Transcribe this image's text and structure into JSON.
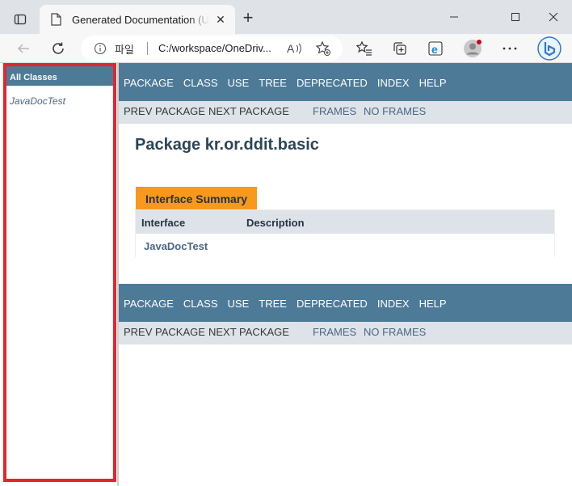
{
  "browser": {
    "tab_title": "Generated Documentation (Untitled)",
    "new_tab_label": "+",
    "address": {
      "site_label": "파일",
      "url": "C:/workspace/OneDriv..."
    }
  },
  "left_frame": {
    "header": "All Classes",
    "classes": [
      "JavaDocTest"
    ]
  },
  "top_navbar": {
    "items": [
      "PACKAGE",
      "CLASS",
      "USE",
      "TREE",
      "DEPRECATED",
      "INDEX",
      "HELP"
    ]
  },
  "top_subnav": {
    "prev": "PREV PACKAGE",
    "next": "NEXT PACKAGE",
    "frames": "FRAMES",
    "no_frames": "NO FRAMES"
  },
  "main": {
    "package_title": "Package kr.or.ddit.basic",
    "summary_tab": "Interface Summary",
    "columns": [
      "Interface",
      "Description"
    ],
    "rows": [
      {
        "name": "JavaDocTest",
        "description": ""
      }
    ]
  },
  "bottom_navbar": {
    "items": [
      "PACKAGE",
      "CLASS",
      "USE",
      "TREE",
      "DEPRECATED",
      "INDEX",
      "HELP"
    ]
  },
  "bottom_subnav": {
    "prev": "PREV PACKAGE",
    "next": "NEXT PACKAGE",
    "frames": "FRAMES",
    "no_frames": "NO FRAMES"
  },
  "colors": {
    "navbar": "#4d7a97",
    "subnav": "#dee3e9",
    "summary_tab": "#f8981d",
    "link": "#4a6782",
    "highlight_border": "#e0262e"
  },
  "icons": [
    "tab-actions-icon",
    "page-icon",
    "close-icon",
    "minimize-icon",
    "maximize-icon",
    "window-close-icon",
    "back-icon",
    "refresh-icon",
    "info-icon",
    "read-aloud-icon",
    "add-favorite-icon",
    "favorites-icon",
    "collections-icon",
    "ie-mode-icon",
    "profile-icon",
    "more-icon",
    "bing-icon"
  ]
}
